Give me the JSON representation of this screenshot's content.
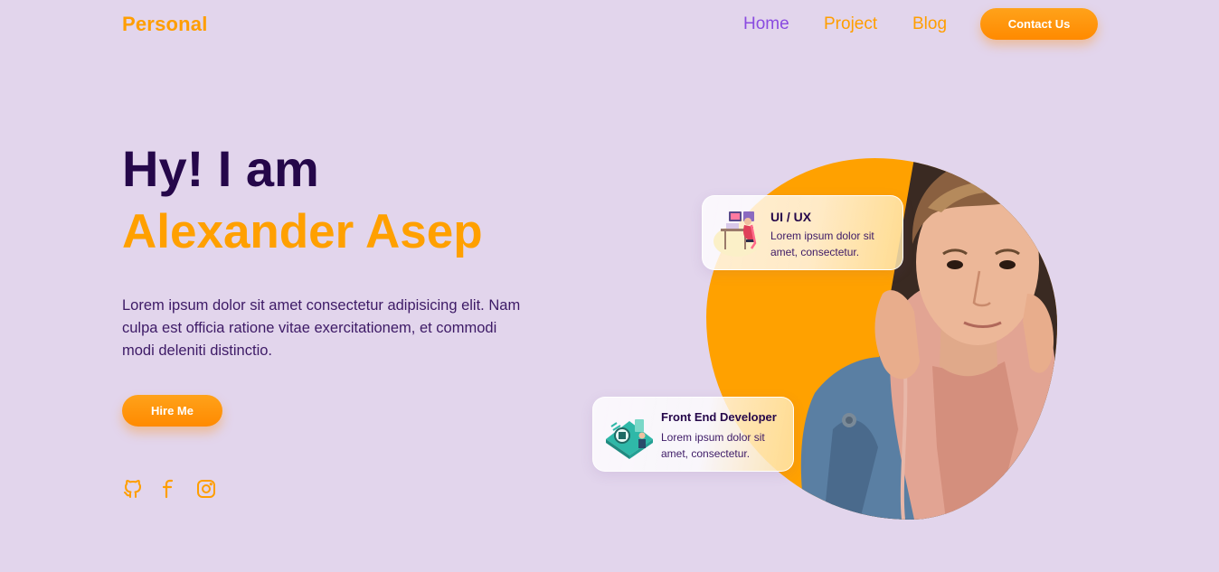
{
  "brand": {
    "logo": "Personal",
    "accent": "#ff9e00",
    "purple": "#25074a",
    "active_nav": "#8a4be0",
    "background": "#e2d5ec"
  },
  "nav": {
    "home": "Home",
    "project": "Project",
    "blog": "Blog",
    "contact": "Contact Us",
    "active": "Home"
  },
  "hero": {
    "greeting": "Hy! I am",
    "name": "Alexander Asep",
    "description": "Lorem ipsum dolor sit amet consectetur adipisicing elit. Nam culpa est officia ratione vitae exercitationem, et commodi modi deleniti distinctio.",
    "hire_button": "Hire Me"
  },
  "social": [
    {
      "icon": "github-icon"
    },
    {
      "icon": "facebook-icon"
    },
    {
      "icon": "instagram-icon"
    }
  ],
  "cards": {
    "uiux": {
      "title": "UI / UX",
      "text": "Lorem ipsum dolor sit amet, consectetur."
    },
    "frontend": {
      "title": "Front End Developer",
      "text": "Lorem ipsum dolor sit amet, consectetur."
    }
  }
}
